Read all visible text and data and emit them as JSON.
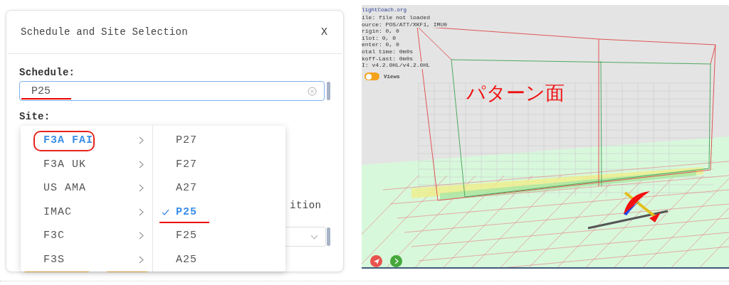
{
  "dialog": {
    "title": "Schedule and Site Selection",
    "close": "X",
    "schedule_label": "Schedule:",
    "schedule_value": "P25",
    "value_underlined": true,
    "site_label": "Site:",
    "partial_label": "ition"
  },
  "menu": {
    "categories": [
      {
        "label": "F3A FAI",
        "selected": true,
        "circled": true
      },
      {
        "label": "F3A UK",
        "selected": false,
        "circled": false
      },
      {
        "label": "US AMA",
        "selected": false,
        "circled": false
      },
      {
        "label": "IMAC",
        "selected": false,
        "circled": false
      },
      {
        "label": "F3C",
        "selected": false,
        "circled": false
      },
      {
        "label": "F3S",
        "selected": false,
        "circled": false
      }
    ],
    "schedules": [
      {
        "label": "P27",
        "selected": false,
        "underlined": false
      },
      {
        "label": "F27",
        "selected": false,
        "underlined": false
      },
      {
        "label": "A27",
        "selected": false,
        "underlined": false
      },
      {
        "label": "P25",
        "selected": true,
        "underlined": true
      },
      {
        "label": "F25",
        "selected": false,
        "underlined": false
      },
      {
        "label": "A25",
        "selected": false,
        "underlined": false
      }
    ]
  },
  "viewer": {
    "info_lines": [
      "lightCoach.org",
      "ile: file not loaded",
      "ource: POS/ATT/XKF1, IMU0",
      "rigin: 0, 0",
      "ilot: 0, 0",
      "enter: 0, 0",
      "otal time: 0m0s",
      "koff-Last: 0m0s",
      "I: v4.2.0HL/v4.2.0HL"
    ],
    "views_toggle": {
      "label": "Views",
      "on": false
    },
    "annotation": "パターン面"
  }
}
